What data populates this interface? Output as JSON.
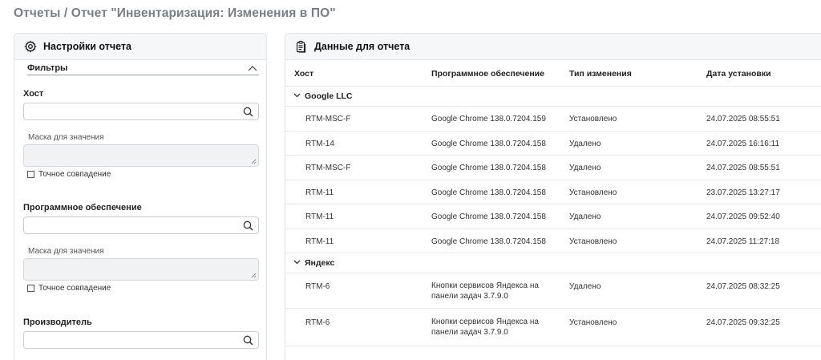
{
  "page": {
    "title": "Отчеты / Отчет \"Инвентаризация: Изменения в ПО\""
  },
  "settings": {
    "title": "Настройки отчета",
    "filters_label": "Фильтры",
    "host": {
      "label": "Хост",
      "search_value": "",
      "mask_label": "Маска для значения",
      "mask_value": "",
      "exact_label": "Точное совпадение",
      "exact_checked": false
    },
    "software": {
      "label": "Программное обеспечение",
      "search_value": "",
      "mask_label": "Маска для значения",
      "mask_value": "",
      "exact_label": "Точное совпадение",
      "exact_checked": false
    },
    "vendor": {
      "label": "Производитель",
      "search_value": ""
    }
  },
  "report": {
    "title": "Данные для отчета",
    "columns": [
      "Хост",
      "Программное обеспечение",
      "Тип изменения",
      "Дата установки"
    ],
    "groups": [
      {
        "name": "Google LLC",
        "rows": [
          {
            "host": "RTM-MSC-F",
            "software": "Google Chrome 138.0.7204.159",
            "type": "Установлено",
            "date": "24.07.2025 08:55:51"
          },
          {
            "host": "RTM-14",
            "software": "Google Chrome 138.0.7204.158",
            "type": "Удалено",
            "date": "24.07.2025 16:16:11"
          },
          {
            "host": "RTM-MSC-F",
            "software": "Google Chrome 138.0.7204.158",
            "type": "Удалено",
            "date": "24.07.2025 08:55:51"
          },
          {
            "host": "RTM-11",
            "software": "Google Chrome 138.0.7204.158",
            "type": "Установлено",
            "date": "23.07.2025 13:27:17"
          },
          {
            "host": "RTM-11",
            "software": "Google Chrome 138.0.7204.158",
            "type": "Удалено",
            "date": "24.07.2025 09:52:40"
          },
          {
            "host": "RTM-11",
            "software": "Google Chrome 138.0.7204.158",
            "type": "Установлено",
            "date": "24.07.2025 11:27:18"
          }
        ]
      },
      {
        "name": "Яндекс",
        "rows": [
          {
            "host": "RTM-6",
            "software_line1": "Кнопки сервисов Яндекса на",
            "software_line2": "панели задач 3.7.9.0",
            "type": "Удалено",
            "date": "24.07.2025 08:32:25"
          },
          {
            "host": "RTM-6",
            "software_line1": "Кнопки сервисов Яндекса на",
            "software_line2": "панели задач 3.7.9.0",
            "type": "Установлено",
            "date": "24.07.2025 09:32:25"
          }
        ]
      }
    ]
  }
}
